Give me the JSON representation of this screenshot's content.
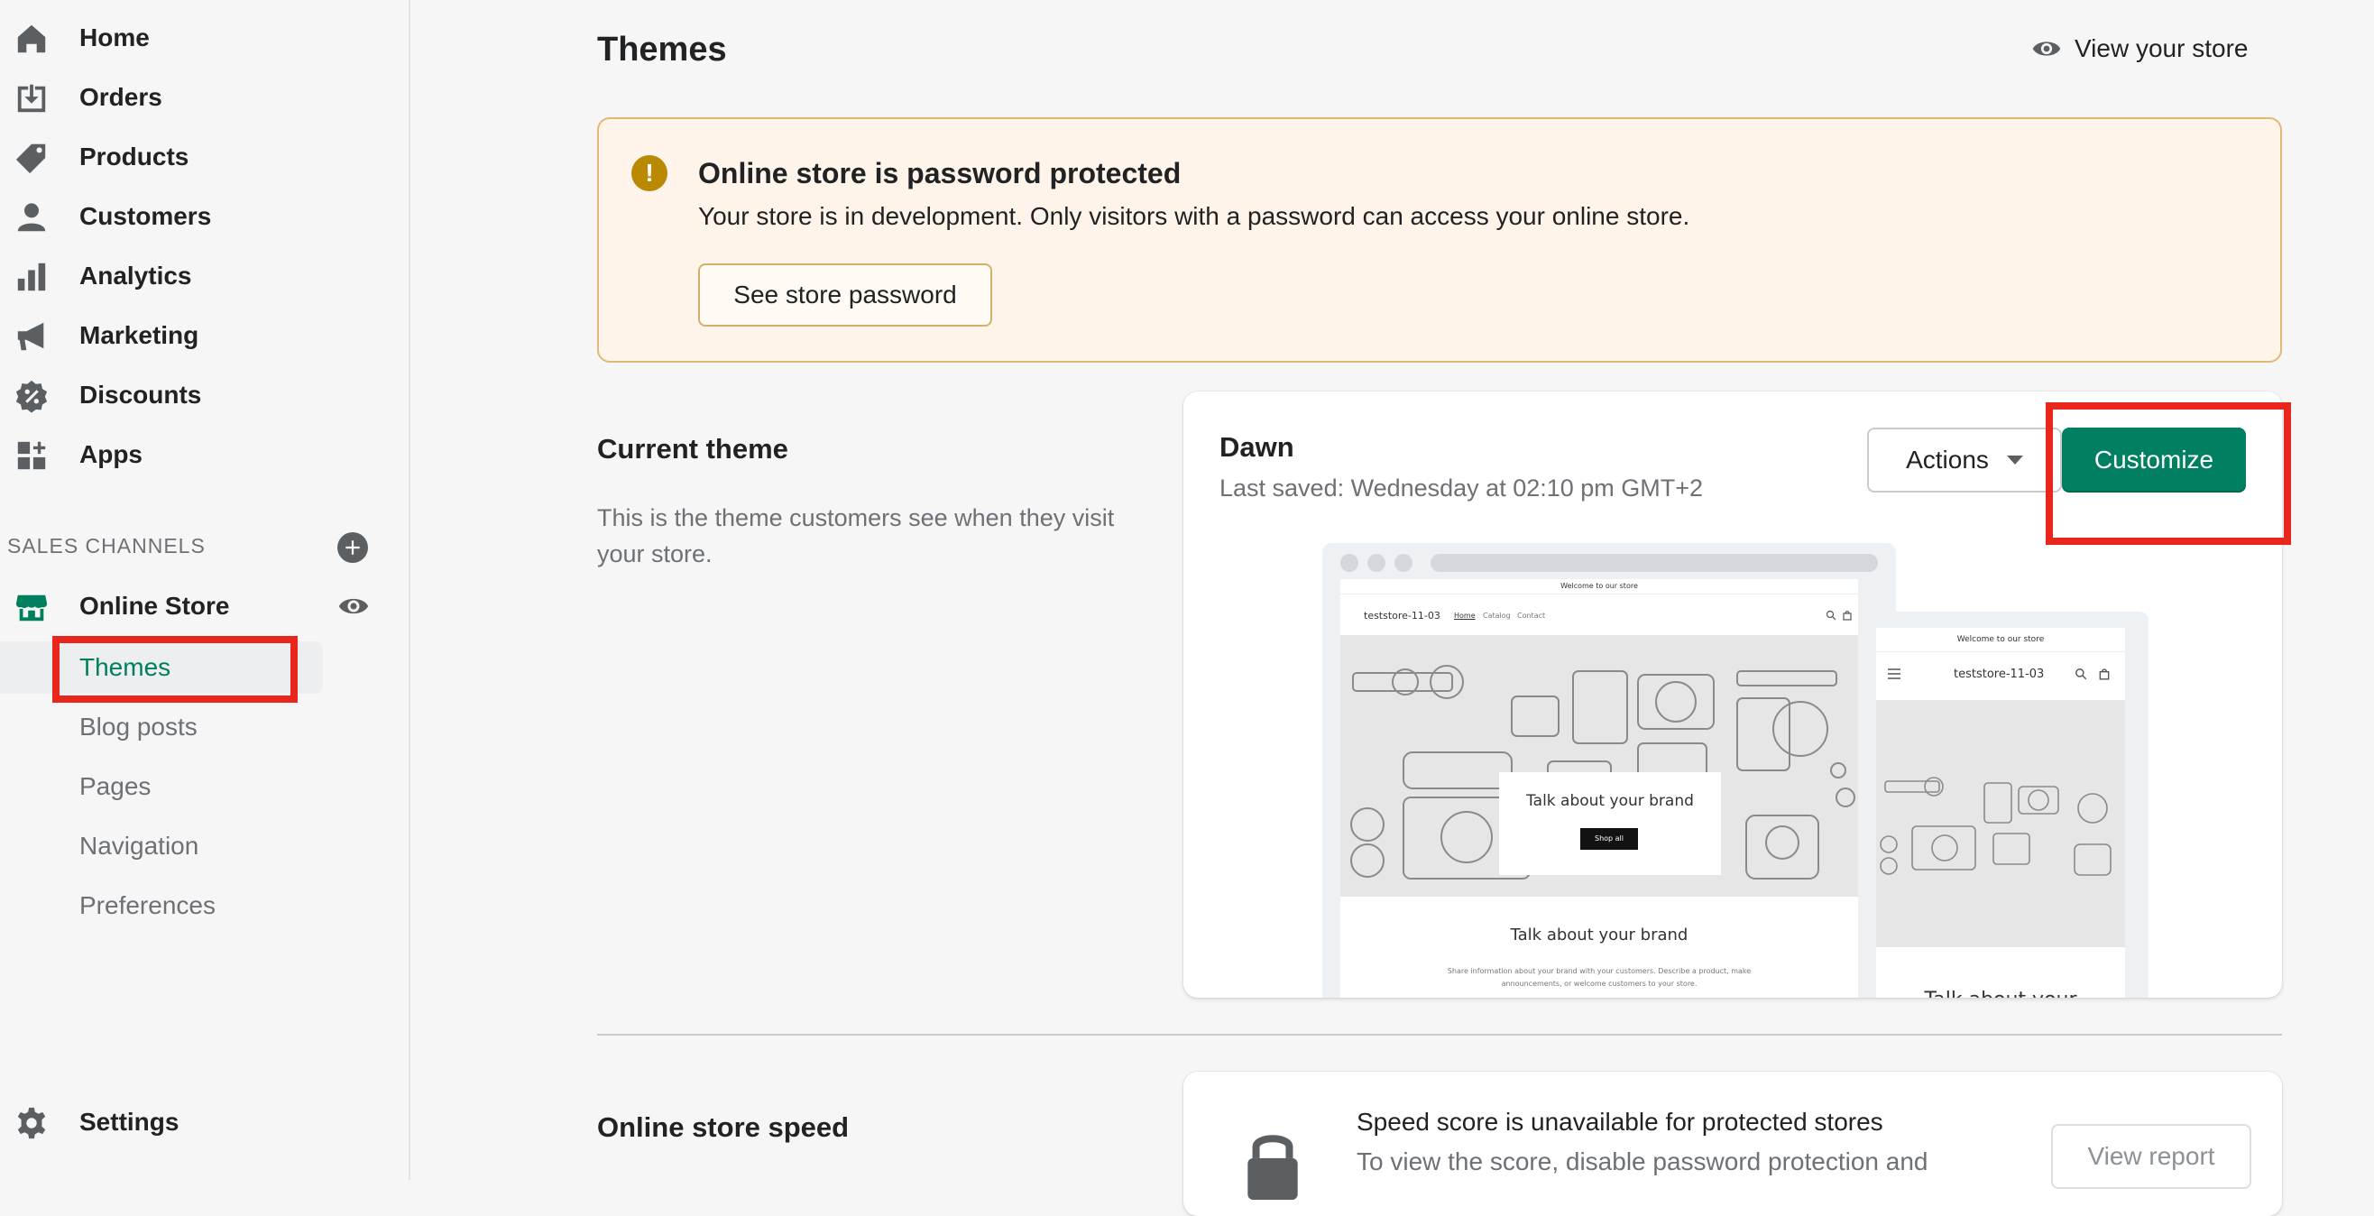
{
  "sidebar": {
    "items": [
      {
        "label": "Home",
        "icon": "home-icon"
      },
      {
        "label": "Orders",
        "icon": "orders-icon"
      },
      {
        "label": "Products",
        "icon": "tag-icon"
      },
      {
        "label": "Customers",
        "icon": "person-icon"
      },
      {
        "label": "Analytics",
        "icon": "bar-chart-icon"
      },
      {
        "label": "Marketing",
        "icon": "megaphone-icon"
      },
      {
        "label": "Discounts",
        "icon": "discount-icon"
      },
      {
        "label": "Apps",
        "icon": "apps-icon"
      }
    ],
    "sales_channels_label": "SALES CHANNELS",
    "online_store": "Online Store",
    "sub_items": [
      "Themes",
      "Blog posts",
      "Pages",
      "Navigation",
      "Preferences"
    ],
    "settings": "Settings"
  },
  "header": {
    "title": "Themes",
    "view_store": "View your store"
  },
  "banner": {
    "title": "Online store is password protected",
    "text": "Your store is in development. Only visitors with a password can access your online store.",
    "button": "See store password"
  },
  "current_theme": {
    "heading": "Current theme",
    "description": "This is the theme customers see when they visit your store.",
    "name": "Dawn",
    "last_saved": "Last saved: Wednesday at 02:10 pm GMT+2",
    "actions_label": "Actions",
    "customize_label": "Customize",
    "preview": {
      "announcement": "Welcome to our store",
      "store_name": "teststore-11-03",
      "nav": [
        "Home",
        "Catalog",
        "Contact"
      ],
      "hero_title": "Talk about your brand",
      "hero_button": "Shop all",
      "section_title": "Talk about your brand",
      "section_text": "Share information about your brand with your customers. Describe a product, make announcements, or welcome customers to your store.",
      "mobile_section_title": "Talk about your"
    }
  },
  "speed": {
    "heading": "Online store speed",
    "title": "Speed score is unavailable for protected stores",
    "text": "To view the score, disable password protection and",
    "button": "View report"
  },
  "colors": {
    "accent": "#008060",
    "banner_bg": "#fff4e9",
    "highlight": "#e8261b"
  }
}
